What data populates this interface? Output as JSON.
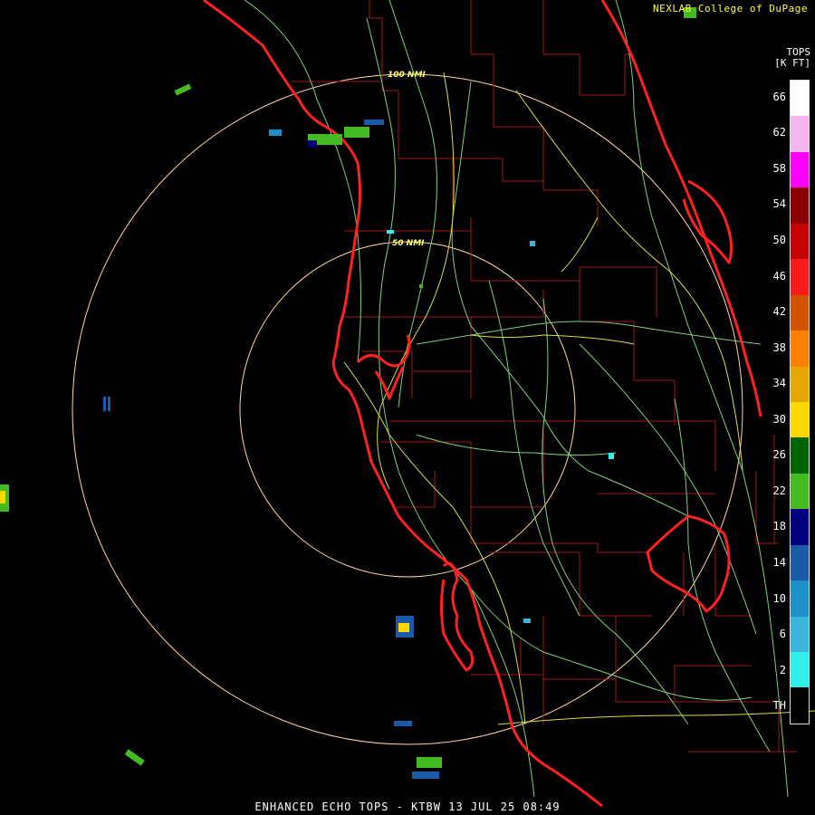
{
  "header": {
    "credit": "NEXLAB College of DuPage"
  },
  "footer": {
    "caption": "ENHANCED ECHO TOPS - KTBW 13 JUL 25 08:49"
  },
  "legend": {
    "title_line1": "TOPS",
    "title_line2": "[K FT]",
    "ticks": [
      "66",
      "62",
      "58",
      "54",
      "50",
      "46",
      "42",
      "38",
      "34",
      "30",
      "26",
      "22",
      "18",
      "14",
      "10",
      "6",
      "2",
      "TH"
    ],
    "colors": [
      "#ffffff",
      "#f4b4ee",
      "#ff00ff",
      "#8b0000",
      "#c80000",
      "#ff1a1a",
      "#d35400",
      "#ff8000",
      "#e6a800",
      "#ffd800",
      "#006400",
      "#44bb22",
      "#00007f",
      "#1a5aa8",
      "#1e90c8",
      "#3cb4dc",
      "#30f0ec",
      "#000000"
    ]
  },
  "rings": {
    "inner_label": "50 NMI",
    "outer_label": "100 NMI"
  },
  "map_colors": {
    "coast": "#ff2020",
    "county": "#a01818",
    "roads_green": "#7fd07f",
    "roads_yellow": "#dddd44",
    "rings": "#ffd7a0"
  }
}
